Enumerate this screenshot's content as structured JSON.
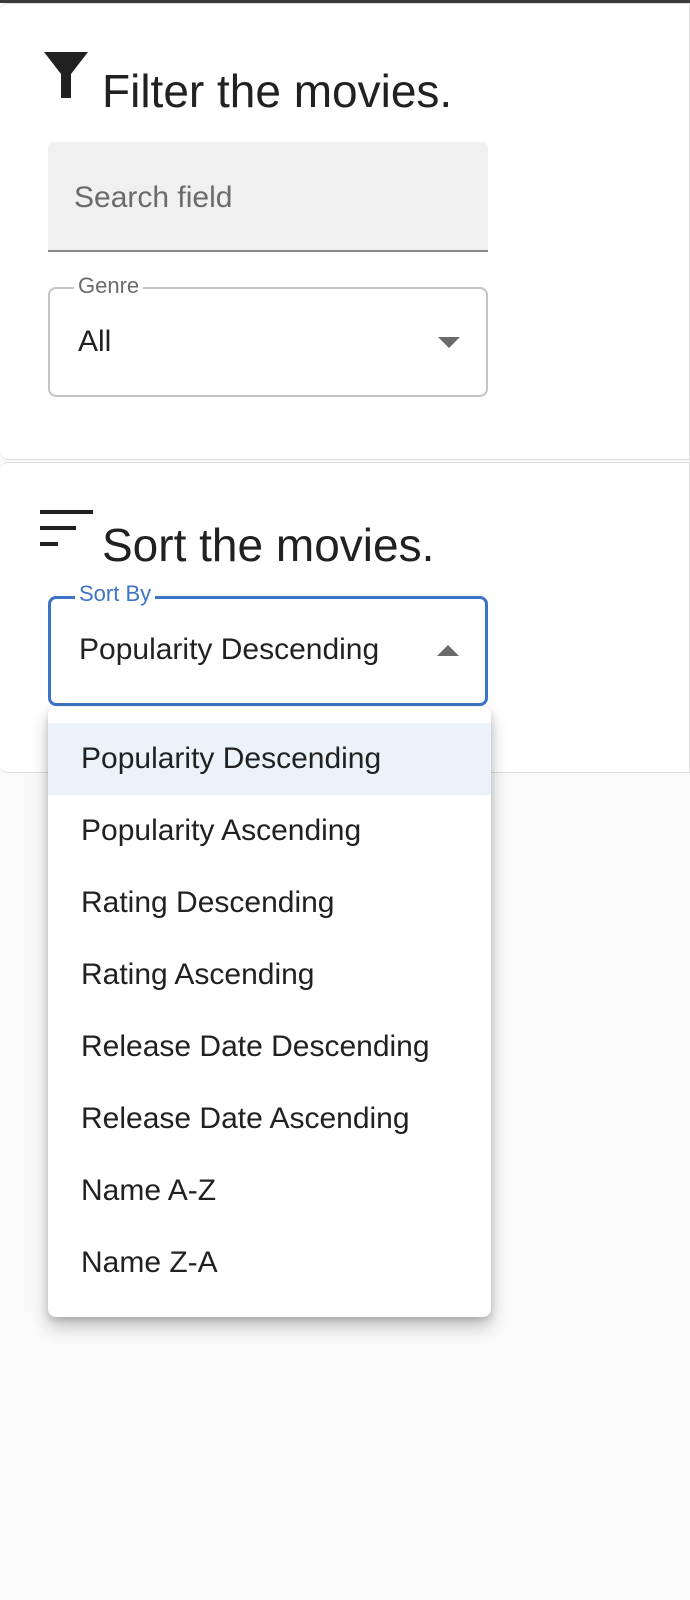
{
  "filter": {
    "title": "Filter the movies.",
    "icon": "filter-icon",
    "search": {
      "placeholder": "Search field",
      "value": ""
    },
    "genre": {
      "label": "Genre",
      "value": "All"
    }
  },
  "sort": {
    "title": "Sort the movies.",
    "icon": "sort-icon",
    "sort_by": {
      "label": "Sort By",
      "value": "Popularity Descending"
    },
    "options": [
      "Popularity Descending",
      "Popularity Ascending",
      "Rating Descending",
      "Rating Ascending",
      "Release Date Descending",
      "Release Date Ascending",
      "Name A-Z",
      "Name Z-A"
    ],
    "selected_index": 0
  },
  "colors": {
    "accent": "#3d74c6",
    "selected_option_bg": "#ecf2fa",
    "field_bg": "#f0f0f0"
  }
}
